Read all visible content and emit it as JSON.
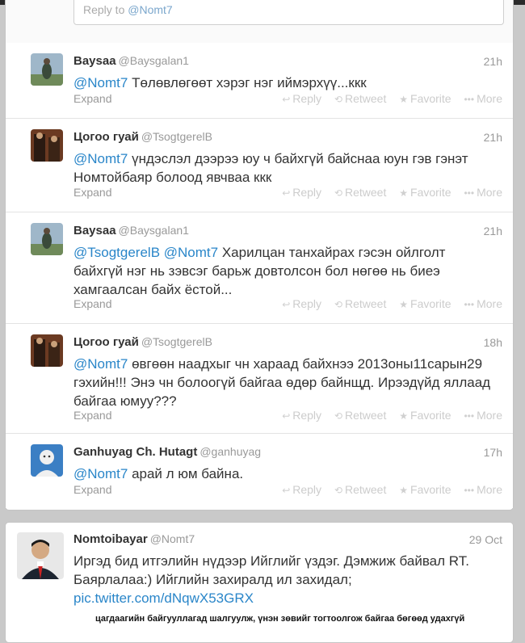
{
  "reply_box": {
    "prefix": "Reply to",
    "mention": "@Nomt7"
  },
  "actions": {
    "reply": "Reply",
    "retweet": "Retweet",
    "favorite": "Favorite",
    "more": "More"
  },
  "expand_label": "Expand",
  "tweets": [
    {
      "name": "Baysaa",
      "handle": "@Baysgalan1",
      "time": "21h",
      "mention": "@Nomt7",
      "text": "Төлөвлөгөөт хэрэг нэг иймэрхүү...ккк"
    },
    {
      "name": "Цогоо гуай",
      "handle": "@TsogtgerelB",
      "time": "21h",
      "mention": "@Nomt7",
      "text": "үндэслэл дээрээ юу ч байхгүй байснаа юун гэв гэнэт Номтойбаяр болоод явчваа ккк"
    },
    {
      "name": "Baysaa",
      "handle": "@Baysgalan1",
      "time": "21h",
      "mention": "@TsogtgerelB @Nomt7",
      "text": "Харилцан танхайрах гэсэн ойлголт байхгүй нэг нь зэвсэг барьж довтолсон бол нөгөө нь биеэ хамгаалсан байх ёстой..."
    },
    {
      "name": "Цогоо гуай",
      "handle": "@TsogtgerelB",
      "time": "18h",
      "mention": "@Nomt7",
      "text": "өвгөөн наадхыг чн хараад байхнээ 2013оны11сарын29 гэхийн!!! Энэ чн болоогүй байгаа өдөр байнщд. Ирээдүйд яллаад байгаа юмуу???"
    },
    {
      "name": "Ganhuyag Ch. Hutagt",
      "handle": "@ganhuyag",
      "time": "17h",
      "mention": "@Nomt7",
      "text": "арай л юм байна."
    }
  ],
  "standalone": {
    "name": "Nomtoibayar",
    "handle": "@Nomt7",
    "time": "29 Oct",
    "text": "Иргэд бид итгэлийн нүдээр Ийглийг үздэг. Дэмжиж байвал RT. Баярлалаа:) Ийглийн захиралд ил захидал;",
    "link": "pic.twitter.com/dNqwX53GRX"
  },
  "caption": "цагдаагийн байгууллагад шалгуулж, үнэн зөвийг тогтоолгож байгаа бөгөөд удахгүй"
}
